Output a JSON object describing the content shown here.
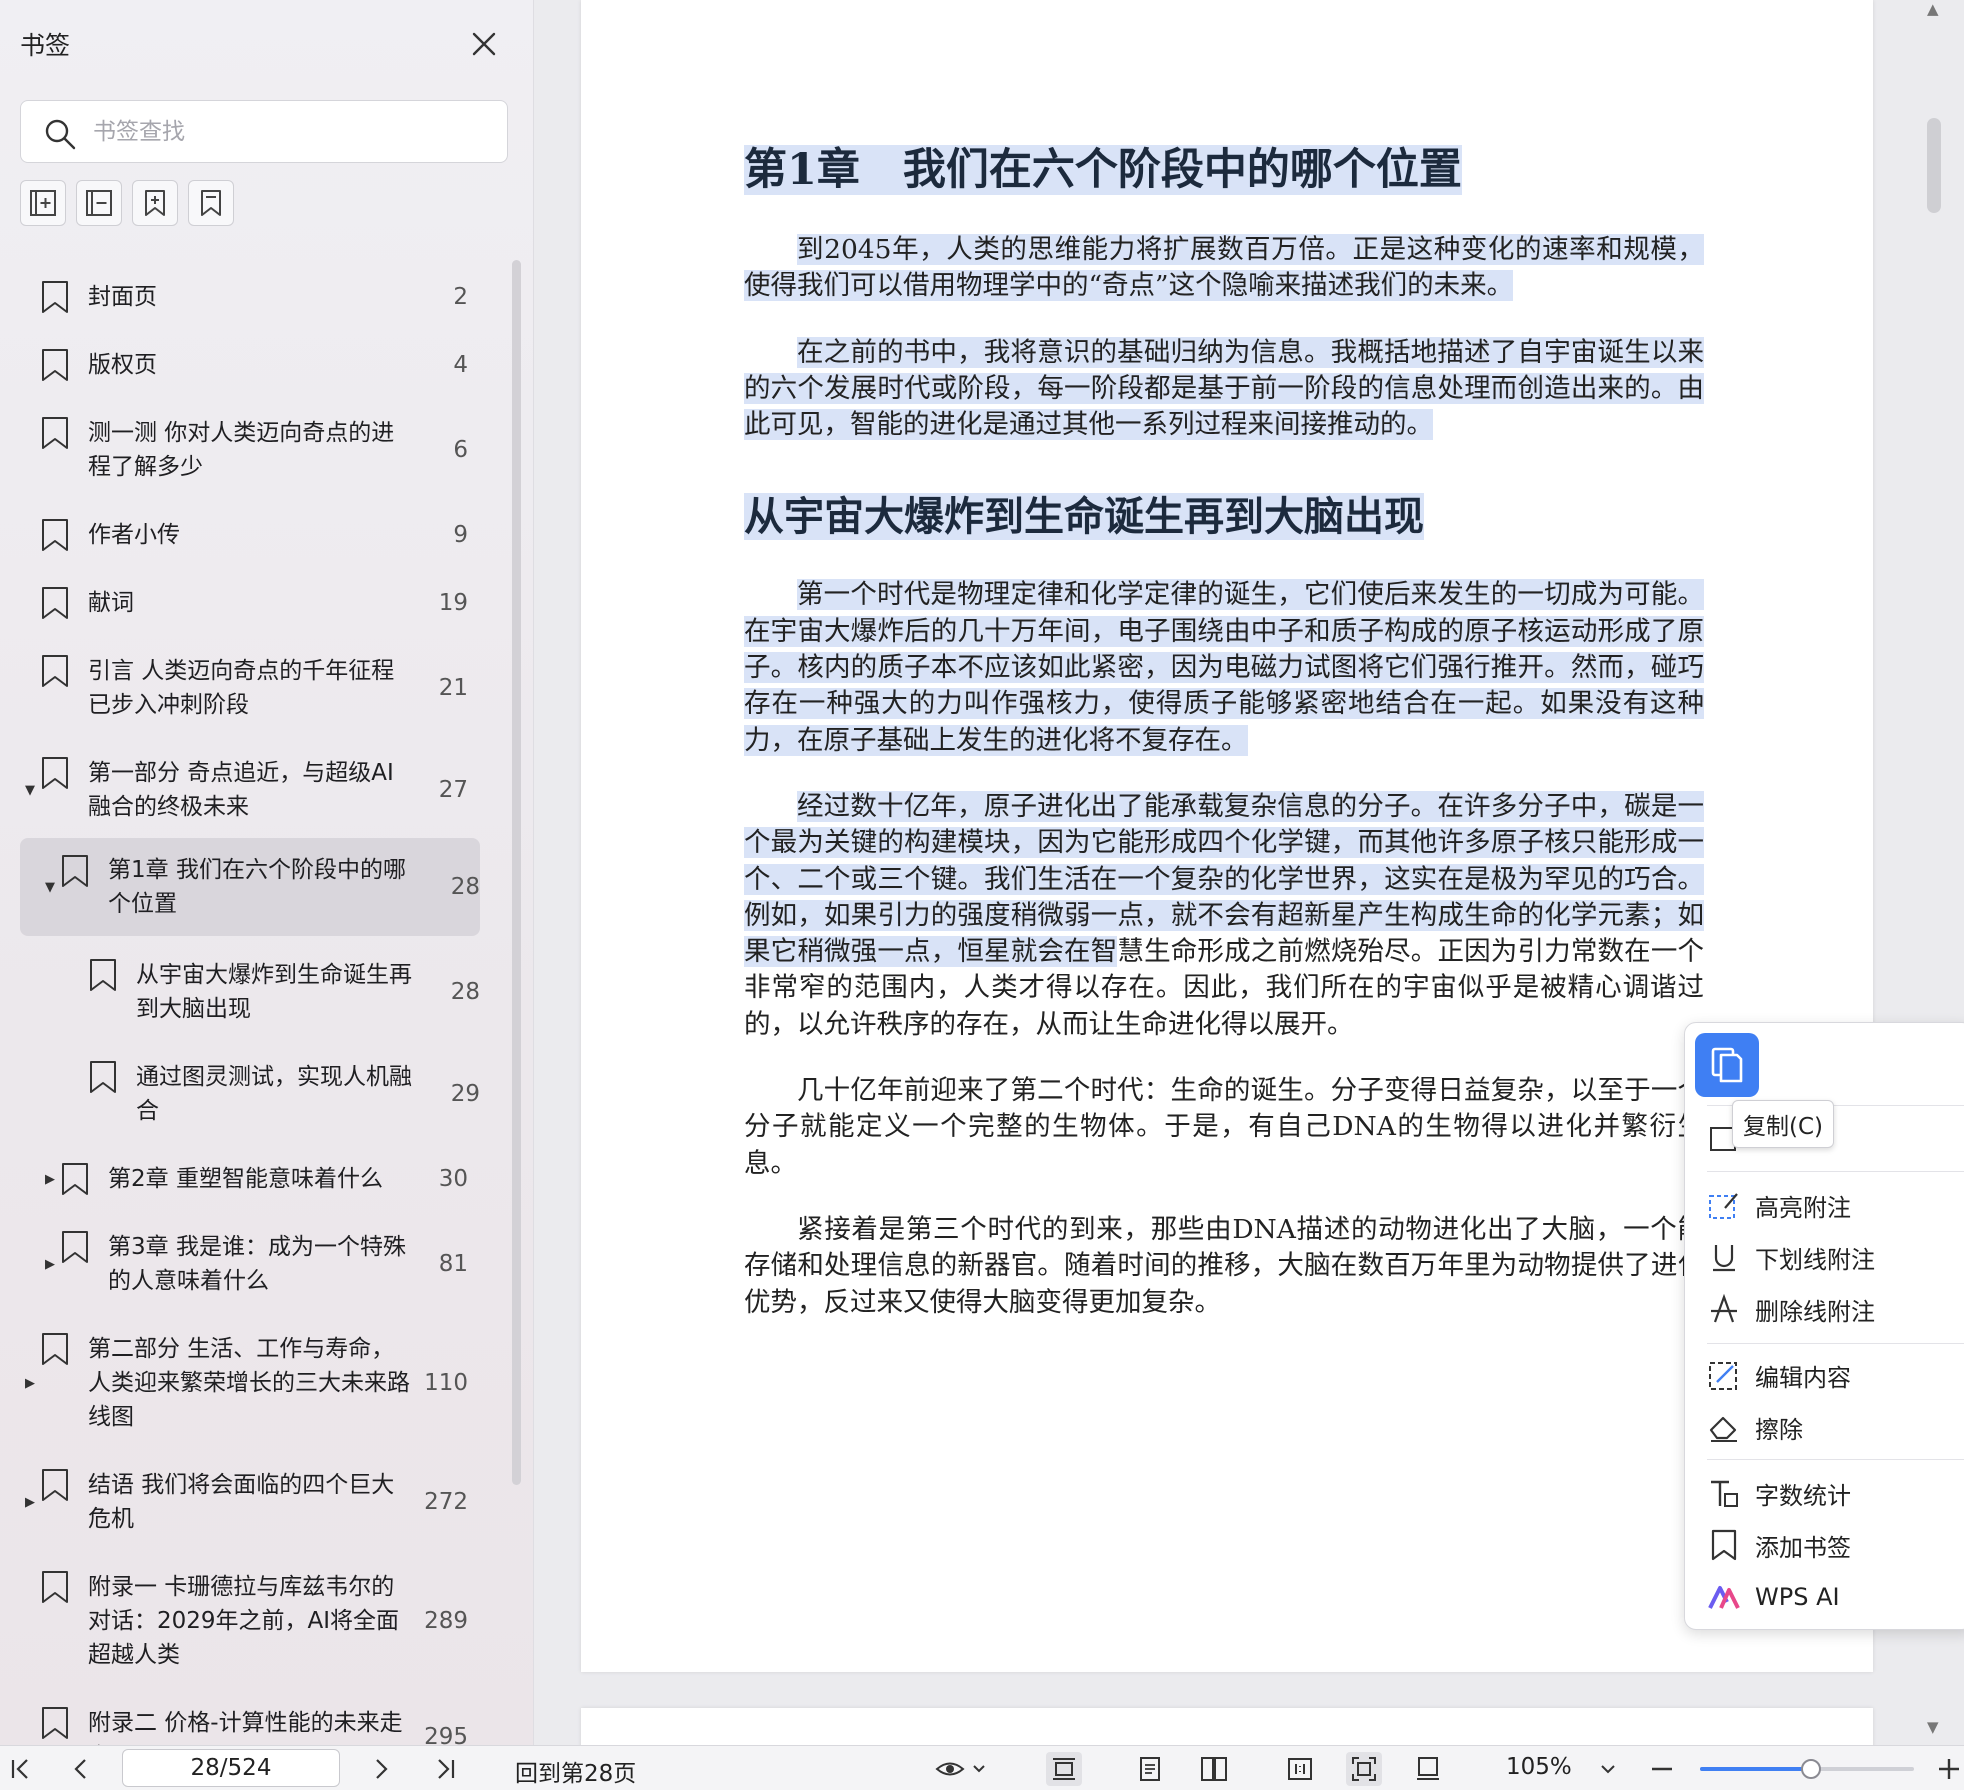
{
  "sidebar": {
    "title": "书签",
    "search_placeholder": "书签查找",
    "bookmarks": [
      {
        "label": "封面页",
        "page": "2",
        "caret": ""
      },
      {
        "label": "版权页",
        "page": "4",
        "caret": ""
      },
      {
        "label": "测一测 你对人类迈向奇点的进程了解多少",
        "page": "6",
        "caret": ""
      },
      {
        "label": "作者小传",
        "page": "9",
        "caret": ""
      },
      {
        "label": "献词",
        "page": "19",
        "caret": ""
      },
      {
        "label": "引言 人类迈向奇点的千年征程已步入冲刺阶段",
        "page": "21",
        "caret": ""
      },
      {
        "label": "第一部分 奇点追近，与超级AI融合的终极未来",
        "page": "27",
        "caret": "▼"
      },
      {
        "label": "第1章 我们在六个阶段中的哪个位置",
        "page": "28",
        "caret": "▼"
      },
      {
        "label": "从宇宙大爆炸到生命诞生再到大脑出现",
        "page": "28",
        "caret": ""
      },
      {
        "label": "通过图灵测试，实现人机融合",
        "page": "29",
        "caret": ""
      },
      {
        "label": "第2章 重塑智能意味着什么",
        "page": "30",
        "caret": "▶"
      },
      {
        "label": "第3章 我是谁：成为一个特殊的人意味着什么",
        "page": "81",
        "caret": "▶"
      },
      {
        "label": "第二部分 生活、工作与寿命，人类迎来繁荣增长的三大未来路线图",
        "page": "110",
        "caret": "▶"
      },
      {
        "label": "结语 我们将会面临的四个巨大危机",
        "page": "272",
        "caret": "▶"
      },
      {
        "label": "附录一 卡珊德拉与库兹韦尔的对话：2029年之前，AI将全面超越人类",
        "page": "289",
        "caret": ""
      },
      {
        "label": "附录二 价格-计算性能的未来走向",
        "page": "295",
        "caret": ""
      }
    ]
  },
  "document": {
    "chapter_title": "第1章　我们在六个阶段中的哪个位置",
    "p1": "到2045年，人类的思维能力将扩展数百万倍。正是这种变化的速率和规模，使得我们可以借用物理学中的“奇点”这个隐喻来描述我们的未来。",
    "p2": "在之前的书中，我将意识的基础归纳为信息。我概括地描述了自宇宙诞生以来的六个发展时代或阶段，每一阶段都是基于前一阶段的信息处理而创造出来的。由此可见，智能的进化是通过其他一系列过程来间接推动的。",
    "section_title": "从宇宙大爆炸到生命诞生再到大脑出现",
    "p3": "第一个时代是物理定律和化学定律的诞生，它们使后来发生的一切成为可能。在宇宙大爆炸后的几十万年间，电子围绕由中子和质子构成的原子核运动形成了原子。核内的质子本不应该如此紧密，因为电磁力试图将它们强行推开。然而，碰巧存在一种强大的力叫作强核力，使得质子能够紧密地结合在一起。如果没有这种力，在原子基础上发生的进化将不复存在。",
    "p4_hl": "经过数十亿年，原子进化出了能承载复杂信息的分子。在许多分子中，碳是一个最为关键的构建模块，因为它能形成四个化学键，而其他许多原子核只能形成一个、二个或三个键。我们生活在一个复杂的化学世界，这实在是极为罕见的巧合。例如，如果引力的强度稍微弱一点，就不会有超新星产生构成生命的化学元素；如果它稍微强一点，恒星就会在智",
    "p4_rest": "慧生命形成之前燃烧殆尽。正因为引力常数在一个非常窄的范围内，人类才得以存在。因此，我们所在的宇宙似乎是被精心调谐过的，以允许秩序的存在，从而让生命进化得以展开。",
    "p5": "几十亿年前迎来了第二个时代：生命的诞生。分子变得日益复杂，以至于一个分子就能定义一个完整的生物体。于是，有自己DNA的生物得以进化并繁衍生息。",
    "p6": "紧接着是第三个时代的到来，那些由DNA描述的动物进化出了大脑，一个能存储和处理信息的新器官。随着时间的推移，大脑在数百万年里为动物提供了进化优势，反过来又使得大脑变得更加复杂。"
  },
  "context_menu": {
    "tooltip": "复制(C)",
    "items": [
      "高亮附注",
      "下划线附注",
      "删除线附注",
      "编辑内容",
      "擦除",
      "字数统计",
      "添加书签",
      "WPS AI"
    ]
  },
  "toolbar": {
    "page_value": "28/524",
    "back_label": "回到第28页",
    "zoom": "105%",
    "zoom_fraction": 0.52
  },
  "colors": {
    "accent": "#3f7ff3",
    "selection": "#d9e3f7",
    "heading": "#1c2a3d"
  }
}
